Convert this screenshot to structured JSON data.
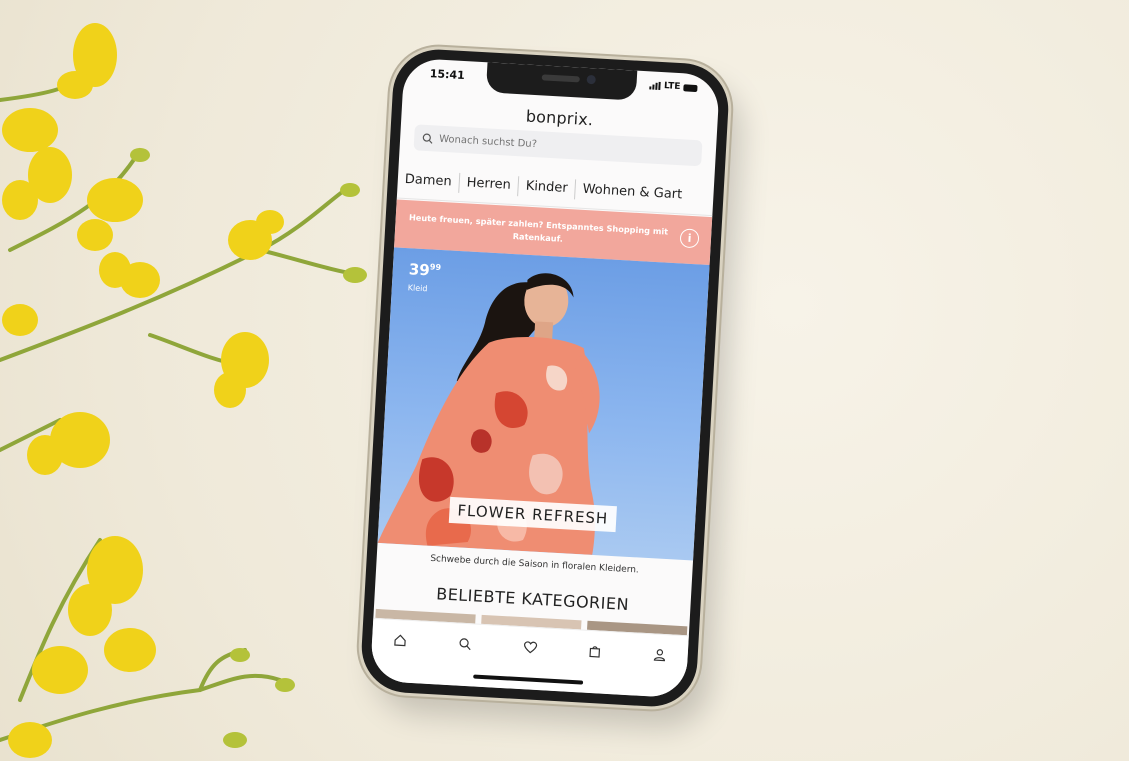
{
  "status_bar": {
    "time": "15:41",
    "network": "LTE"
  },
  "app": {
    "logo": "bonprix."
  },
  "search": {
    "placeholder": "Wonach suchst Du?"
  },
  "tabs": [
    {
      "label": "Damen"
    },
    {
      "label": "Herren"
    },
    {
      "label": "Kinder"
    },
    {
      "label": "Wohnen & Gart"
    }
  ],
  "promo": {
    "text": "Heute freuen, später zahlen? Entspanntes Shopping mit Ratenkauf."
  },
  "hero": {
    "price_main": "39",
    "price_cents": "99",
    "price_label": "Kleid",
    "title": "FLOWER REFRESH",
    "subtitle": "Schwebe durch die Saison in floralen Kleidern."
  },
  "section": {
    "title": "BELIEBTE KATEGORIEN"
  },
  "bottom_nav": [
    "home-icon",
    "search-icon",
    "heart-icon",
    "bag-icon",
    "user-icon"
  ],
  "colors": {
    "promo": "#f2a79c",
    "hero_sky": "#7ba9eb",
    "background": "#f3eee0",
    "flower": "#f0d21a"
  }
}
